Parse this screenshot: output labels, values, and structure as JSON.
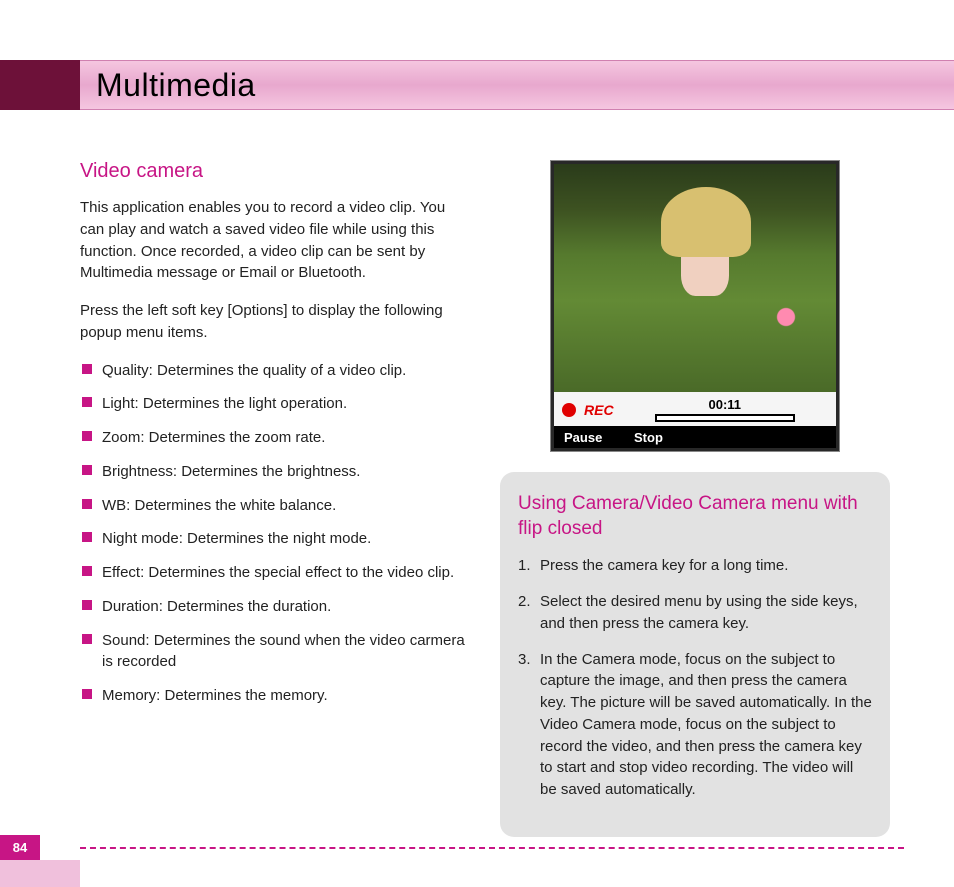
{
  "page_number": "84",
  "banner_title": "Multimedia",
  "left": {
    "heading": "Video camera",
    "intro": "This application enables you to record a video clip. You can play and watch a saved video file while using this function. Once recorded, a video clip can be sent by Multimedia message or Email or Bluetooth.",
    "instruction": "Press the left soft key [Options] to display the following popup menu items.",
    "bullets": [
      "Quality: Determines the quality of a video clip.",
      "Light: Determines the light operation.",
      "Zoom: Determines the zoom rate.",
      "Brightness: Determines the brightness.",
      "WB: Determines the white balance.",
      "Night mode: Determines the night mode.",
      "Effect: Determines the special effect to the video clip.",
      "Duration: Determines the duration.",
      "Sound: Determines the sound when the video carmera is recorded",
      "Memory: Determines the memory."
    ]
  },
  "phone": {
    "rec_label": "REC",
    "rec_time": "00:11",
    "softkey_left": "Pause",
    "softkey_center": "Stop"
  },
  "info_box": {
    "heading": "Using Camera/Video Camera menu with flip closed",
    "steps": [
      "Press the camera key for a long time.",
      "Select the desired menu by using the side keys, and then press the camera key.",
      "In the Camera mode, focus on the subject to capture the image, and then press the camera key. The picture will be saved automatically. In the Video Camera mode, focus on the subject to record the video, and then press the camera key to start and stop video recording. The video will be saved automatically."
    ]
  }
}
